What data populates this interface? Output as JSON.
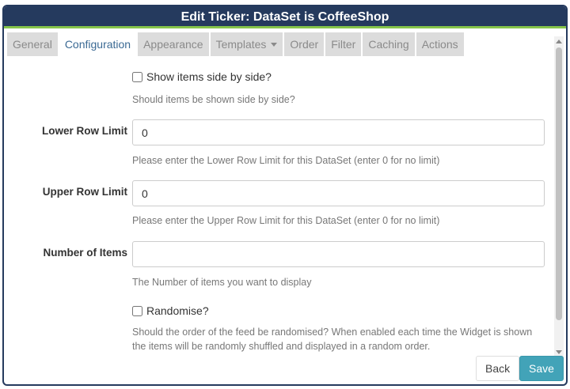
{
  "dialog": {
    "title": "Edit Ticker: DataSet is CoffeeShop"
  },
  "tabs": [
    {
      "label": "General"
    },
    {
      "label": "Configuration"
    },
    {
      "label": "Appearance"
    },
    {
      "label": "Templates"
    },
    {
      "label": "Order"
    },
    {
      "label": "Filter"
    },
    {
      "label": "Caching"
    },
    {
      "label": "Actions"
    }
  ],
  "form": {
    "side_by_side": {
      "label": "Show items side by side?",
      "help": "Should items be shown side by side?",
      "checked": false
    },
    "lower_row_limit": {
      "label": "Lower Row Limit",
      "value": "0",
      "help": "Please enter the Lower Row Limit for this DataSet (enter 0 for no limit)"
    },
    "upper_row_limit": {
      "label": "Upper Row Limit",
      "value": "0",
      "help": "Please enter the Upper Row Limit for this DataSet (enter 0 for no limit)"
    },
    "number_of_items": {
      "label": "Number of Items",
      "value": "",
      "help": "The Number of items you want to display"
    },
    "randomise": {
      "label": "Randomise?",
      "help_line1": "Should the order of the feed be randomised? When enabled each time the Widget is shown",
      "help_line2": "the items will be randomly shuffled and displayed in a random order.",
      "checked": false
    }
  },
  "buttons": {
    "back": "Back",
    "save": "Save"
  },
  "colors": {
    "titlebar": "#253a5e",
    "accent_line": "#86c54a",
    "save": "#42a3b8",
    "active_tab_text": "#3b6a94"
  }
}
